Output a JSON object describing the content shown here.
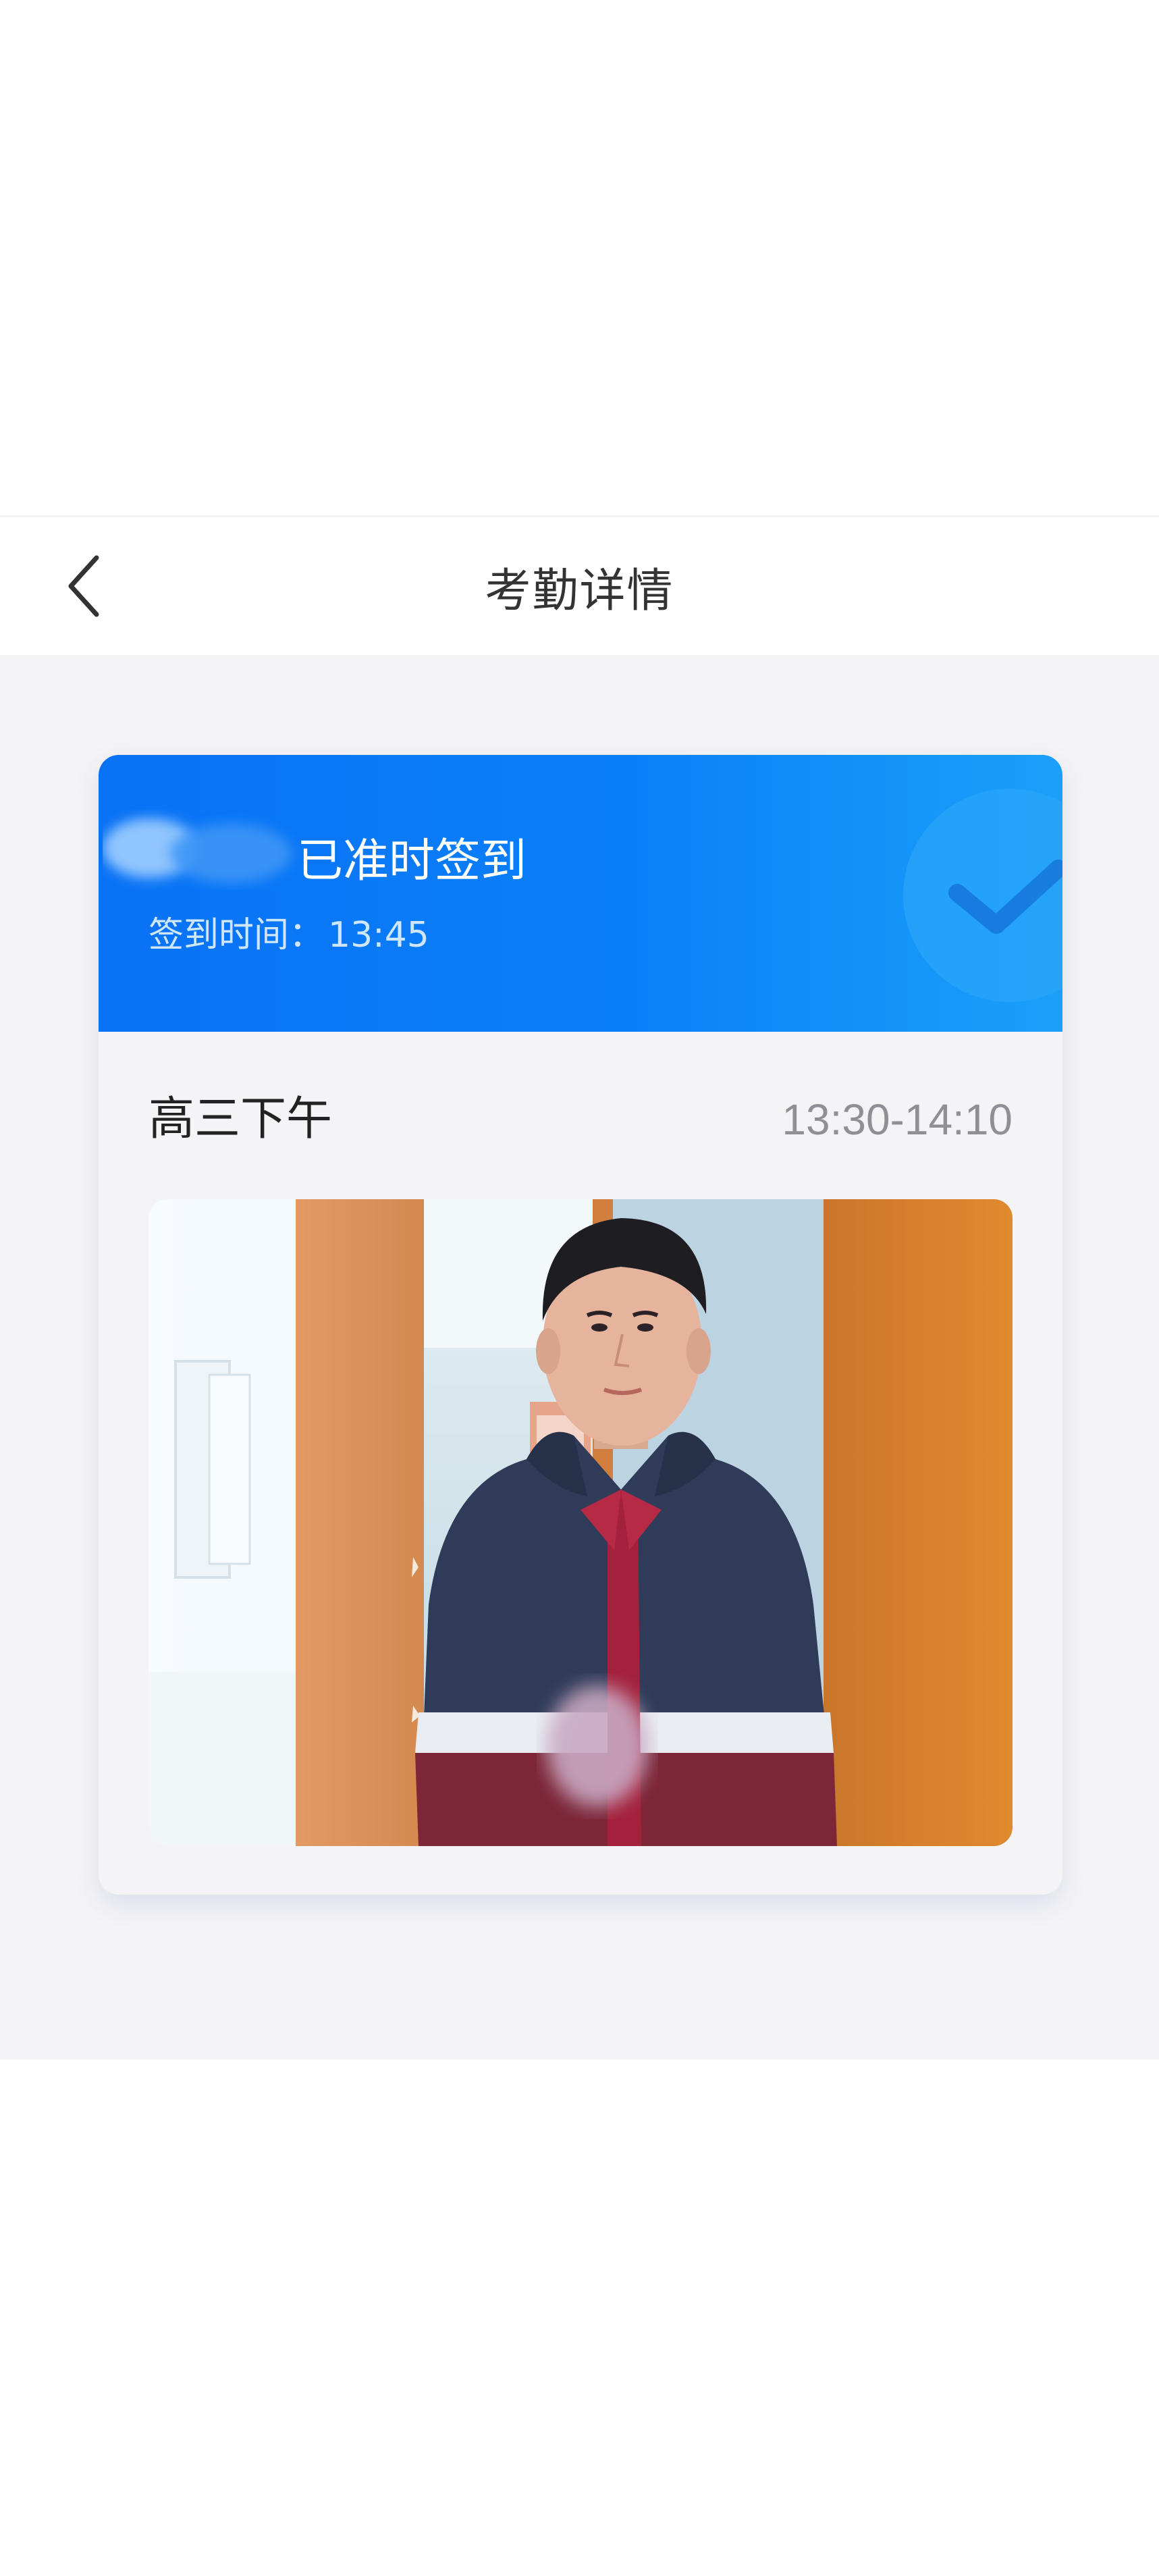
{
  "navbar": {
    "title": "考勤详情",
    "back_icon": "chevron-left-icon"
  },
  "card": {
    "status_text": "已准时签到",
    "checkin_label": "签到时间：",
    "checkin_time": "13:45",
    "badge_icon": "checkmark-circle-icon",
    "session_name": "高三下午",
    "session_time": "13:30-14:10",
    "photo_icon": "student-photo"
  },
  "colors": {
    "header_blue": "#0a72f5",
    "header_blue_light": "#1aa0fa",
    "page_bg": "#f4f4f7",
    "title_text": "#333333",
    "time_text": "#8f8f95"
  }
}
